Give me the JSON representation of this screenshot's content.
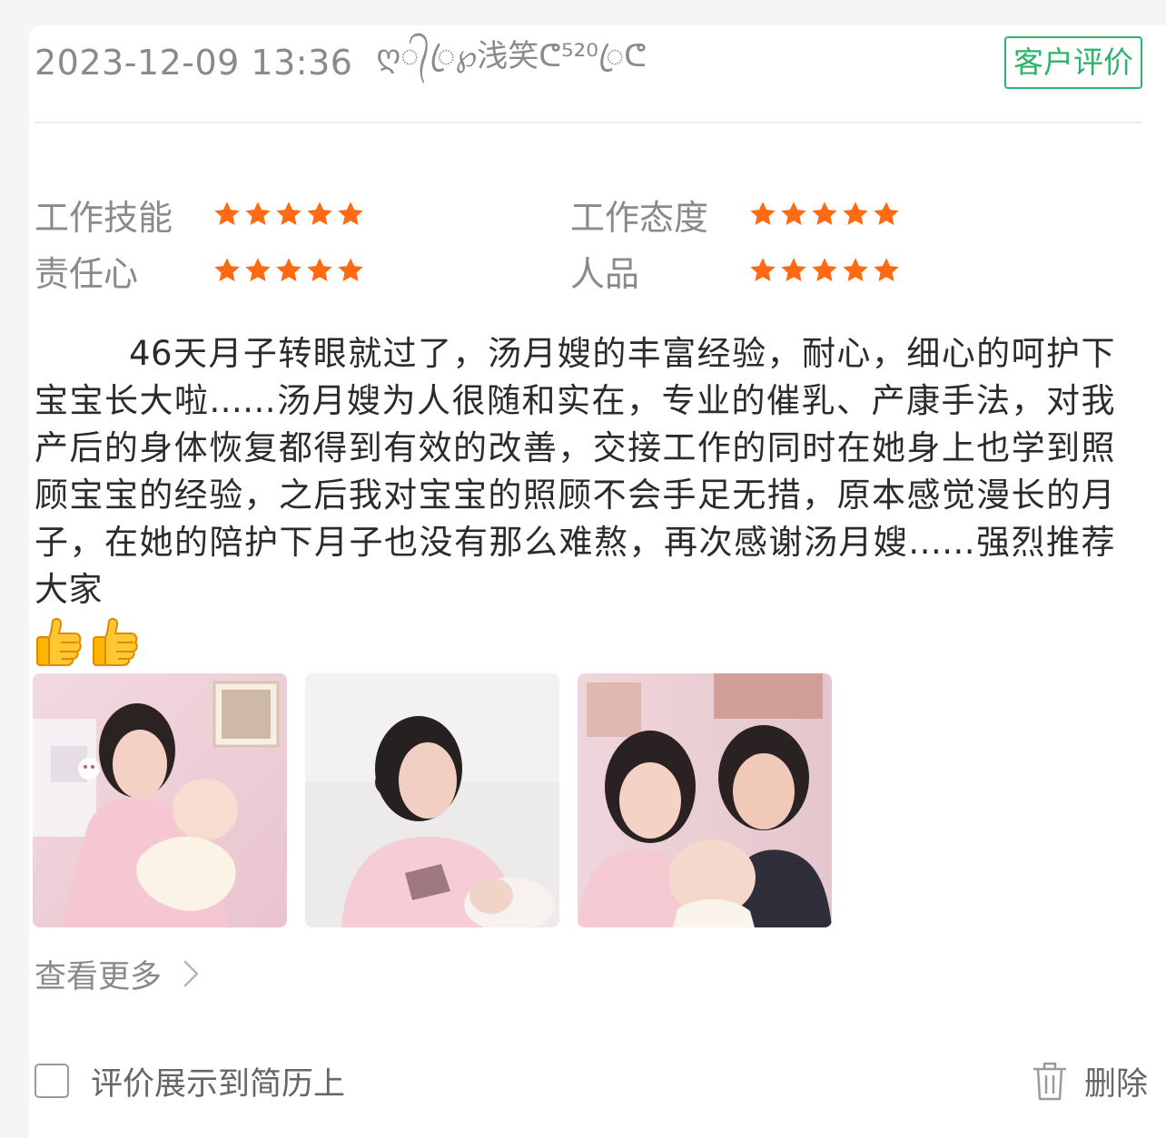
{
  "header": {
    "datetime": "2023-12-09 13:36",
    "username": "ღ᭄ꦿ℘浅笑ᕦ⁵²⁰ꦿᕦ",
    "badge": "客户评价"
  },
  "ratings": [
    {
      "label": "工作技能",
      "stars": 5,
      "max": 5
    },
    {
      "label": "工作态度",
      "stars": 5,
      "max": 5
    },
    {
      "label": "责任心",
      "stars": 5,
      "max": 5
    },
    {
      "label": "人品",
      "stars": 5,
      "max": 5
    }
  ],
  "review": {
    "text": "46天月子转眼就过了，汤月嫂的丰富经验，耐心，细心的呵护下宝宝长大啦......汤月嫂为人很随和实在，专业的催乳、产康手法，对我产后的身体恢复都得到有效的改善，交接工作的同时在她身上也学到照顾宝宝的经验，之后我对宝宝的照顾不会手足无措，原本感觉漫长的月子，在她的陪护下月子也没有那么难熬，再次感谢汤月嫂......强烈推荐大家"
  },
  "emoji": [
    "thumbs-up-icon",
    "thumbs-up-icon"
  ],
  "photos": [
    {
      "name": "review-photo-1"
    },
    {
      "name": "review-photo-2"
    },
    {
      "name": "review-photo-3"
    }
  ],
  "more": {
    "label": "查看更多"
  },
  "footer": {
    "checkbox_label": "评价展示到简历上",
    "checkbox_checked": false,
    "delete_label": "删除"
  },
  "colors": {
    "accent_green": "#2fb36b",
    "star_orange": "#ff6a13",
    "muted_text": "#8a8a8a"
  }
}
